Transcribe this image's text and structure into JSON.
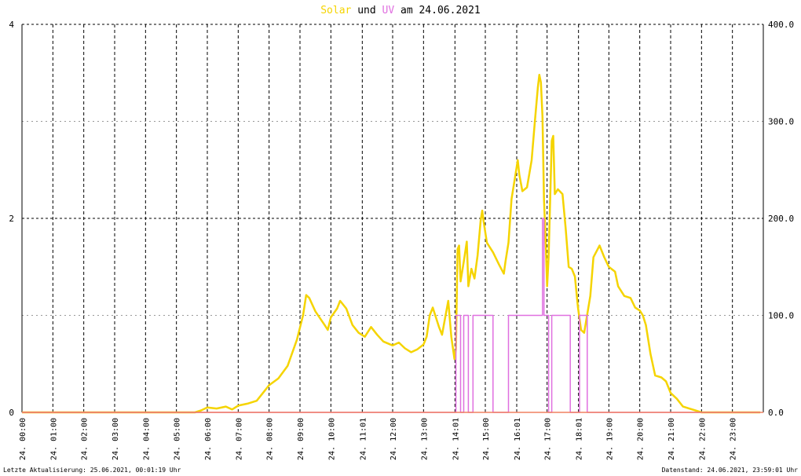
{
  "chart_data": {
    "type": "line",
    "title_parts": [
      {
        "text": "Solar",
        "color": "#f5d400"
      },
      {
        "text": " und ",
        "color": "#000000"
      },
      {
        "text": "UV",
        "color": "#e070e0"
      },
      {
        "text": " am 24.06.2021",
        "color": "#000000"
      }
    ],
    "x_ticks": [
      "24. 00:00",
      "24. 01:00",
      "24. 02:00",
      "24. 03:00",
      "24. 04:00",
      "24. 05:00",
      "24. 06:00",
      "24. 07:00",
      "24. 08:00",
      "24. 09:00",
      "24. 10:00",
      "24. 11:01",
      "24. 12:00",
      "24. 13:00",
      "24. 14:01",
      "24. 15:00",
      "24. 16:01",
      "24. 17:00",
      "24. 18:01",
      "24. 19:00",
      "24. 20:00",
      "24. 21:00",
      "24. 22:00",
      "24. 23:00"
    ],
    "x_tick_hours": [
      0,
      1,
      2,
      3,
      4,
      5,
      6,
      7,
      8,
      9,
      10,
      11.017,
      12,
      13,
      14.017,
      15,
      16.017,
      17,
      18.017,
      19,
      20,
      21,
      22,
      23
    ],
    "xlim_hours": [
      0,
      24
    ],
    "y_left": {
      "ticks": [
        "0",
        "2",
        "4"
      ],
      "tick_values": [
        0,
        2,
        4
      ],
      "lim": [
        0,
        4
      ]
    },
    "y_right": {
      "ticks": [
        "0.0",
        "100.0",
        "200.0",
        "300.0",
        "400.0"
      ],
      "tick_values": [
        0,
        100,
        200,
        300,
        400
      ],
      "lim": [
        0,
        400
      ]
    },
    "grid": true,
    "series": [
      {
        "name": "Solar",
        "axis": "right",
        "color": "#f5d400",
        "points": [
          [
            0,
            0
          ],
          [
            5.6,
            0
          ],
          [
            5.8,
            2
          ],
          [
            6.0,
            5
          ],
          [
            6.3,
            4
          ],
          [
            6.6,
            6
          ],
          [
            6.8,
            3
          ],
          [
            7.0,
            7
          ],
          [
            7.3,
            9
          ],
          [
            7.6,
            12
          ],
          [
            7.8,
            20
          ],
          [
            8.0,
            28
          ],
          [
            8.3,
            35
          ],
          [
            8.6,
            48
          ],
          [
            8.9,
            75
          ],
          [
            9.1,
            100
          ],
          [
            9.2,
            121
          ],
          [
            9.3,
            118
          ],
          [
            9.5,
            104
          ],
          [
            9.8,
            90
          ],
          [
            9.9,
            85
          ],
          [
            10.0,
            98
          ],
          [
            10.2,
            107
          ],
          [
            10.3,
            115
          ],
          [
            10.5,
            107
          ],
          [
            10.7,
            90
          ],
          [
            10.9,
            82
          ],
          [
            11.1,
            78
          ],
          [
            11.3,
            88
          ],
          [
            11.5,
            80
          ],
          [
            11.7,
            73
          ],
          [
            12.0,
            69
          ],
          [
            12.2,
            72
          ],
          [
            12.4,
            66
          ],
          [
            12.6,
            62
          ],
          [
            12.8,
            65
          ],
          [
            13.0,
            70
          ],
          [
            13.1,
            78
          ],
          [
            13.2,
            100
          ],
          [
            13.3,
            108
          ],
          [
            13.5,
            88
          ],
          [
            13.6,
            80
          ],
          [
            13.8,
            115
          ],
          [
            13.9,
            78
          ],
          [
            14.0,
            55
          ],
          [
            14.05,
            65
          ],
          [
            14.1,
            168
          ],
          [
            14.15,
            172
          ],
          [
            14.2,
            135
          ],
          [
            14.3,
            155
          ],
          [
            14.4,
            176
          ],
          [
            14.45,
            130
          ],
          [
            14.55,
            148
          ],
          [
            14.65,
            138
          ],
          [
            14.75,
            162
          ],
          [
            14.85,
            198
          ],
          [
            14.9,
            208
          ],
          [
            14.95,
            196
          ],
          [
            15.05,
            175
          ],
          [
            15.25,
            165
          ],
          [
            15.45,
            152
          ],
          [
            15.6,
            143
          ],
          [
            15.65,
            155
          ],
          [
            15.75,
            175
          ],
          [
            15.85,
            220
          ],
          [
            15.95,
            240
          ],
          [
            16.05,
            260
          ],
          [
            16.1,
            245
          ],
          [
            16.2,
            228
          ],
          [
            16.35,
            232
          ],
          [
            16.5,
            260
          ],
          [
            16.6,
            298
          ],
          [
            16.7,
            335
          ],
          [
            16.75,
            348
          ],
          [
            16.8,
            340
          ],
          [
            16.85,
            305
          ],
          [
            16.9,
            220
          ],
          [
            16.95,
            180
          ],
          [
            17.0,
            130
          ],
          [
            17.05,
            160
          ],
          [
            17.15,
            280
          ],
          [
            17.2,
            285
          ],
          [
            17.25,
            225
          ],
          [
            17.35,
            230
          ],
          [
            17.5,
            225
          ],
          [
            17.6,
            190
          ],
          [
            17.7,
            150
          ],
          [
            17.8,
            148
          ],
          [
            17.9,
            140
          ],
          [
            18.0,
            108
          ],
          [
            18.1,
            85
          ],
          [
            18.2,
            82
          ],
          [
            18.4,
            120
          ],
          [
            18.5,
            160
          ],
          [
            18.7,
            172
          ],
          [
            18.85,
            160
          ],
          [
            19.0,
            150
          ],
          [
            19.2,
            145
          ],
          [
            19.3,
            130
          ],
          [
            19.5,
            120
          ],
          [
            19.7,
            118
          ],
          [
            19.85,
            108
          ],
          [
            20.0,
            105
          ],
          [
            20.1,
            100
          ],
          [
            20.2,
            90
          ],
          [
            20.35,
            60
          ],
          [
            20.5,
            38
          ],
          [
            20.7,
            36
          ],
          [
            20.85,
            32
          ],
          [
            21.0,
            20
          ],
          [
            21.2,
            14
          ],
          [
            21.4,
            6
          ],
          [
            21.6,
            4
          ],
          [
            21.8,
            2
          ],
          [
            22.0,
            0
          ],
          [
            23.9,
            0
          ]
        ]
      },
      {
        "name": "UV",
        "axis": "left",
        "color": "#e070e0",
        "points": [
          [
            0,
            0
          ],
          [
            14.05,
            0
          ],
          [
            14.05,
            1
          ],
          [
            14.2,
            1
          ],
          [
            14.2,
            0
          ],
          [
            14.3,
            0
          ],
          [
            14.3,
            1
          ],
          [
            14.45,
            1
          ],
          [
            14.45,
            0
          ],
          [
            14.6,
            0
          ],
          [
            14.6,
            1
          ],
          [
            15.25,
            1
          ],
          [
            15.25,
            0
          ],
          [
            15.75,
            0
          ],
          [
            15.75,
            1
          ],
          [
            16.85,
            1
          ],
          [
            16.85,
            2
          ],
          [
            16.9,
            2
          ],
          [
            16.9,
            1
          ],
          [
            17.05,
            1
          ],
          [
            17.05,
            0
          ],
          [
            17.15,
            0
          ],
          [
            17.15,
            1
          ],
          [
            17.75,
            1
          ],
          [
            17.75,
            0
          ],
          [
            18.05,
            0
          ],
          [
            18.05,
            1
          ],
          [
            18.3,
            1
          ],
          [
            18.3,
            0
          ],
          [
            23.9,
            0
          ]
        ]
      }
    ]
  },
  "footer": {
    "left": "Letzte Aktualisierung: 25.06.2021, 00:01:19 Uhr",
    "right": "Datenstand: 24.06.2021, 23:59:01 Uhr"
  }
}
